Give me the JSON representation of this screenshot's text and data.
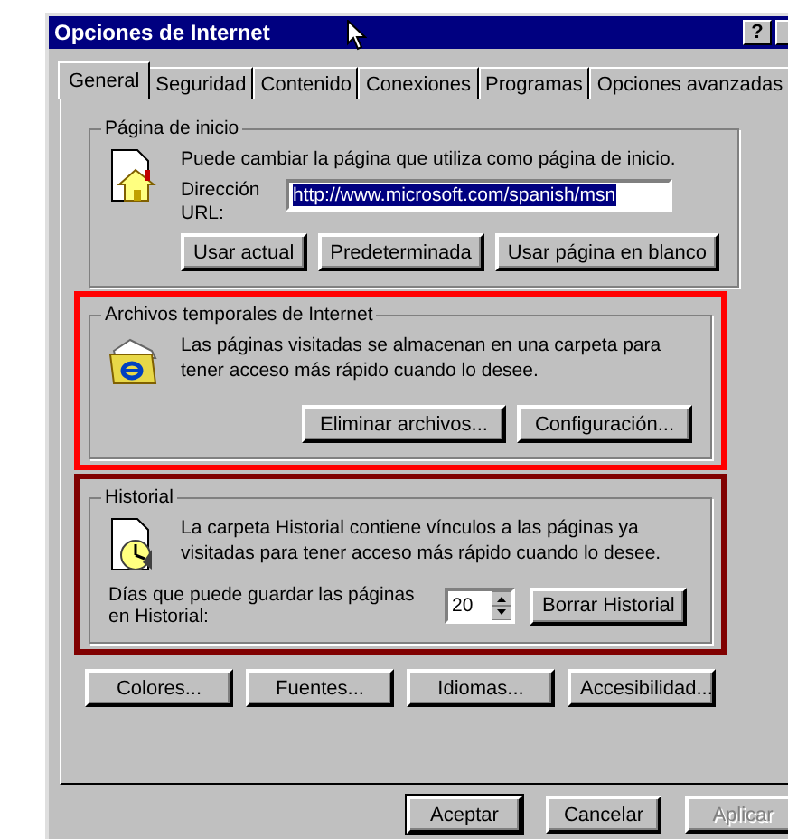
{
  "window": {
    "title": "Opciones de Internet",
    "help_button": "?"
  },
  "tabs": [
    {
      "label": "General",
      "selected": true
    },
    {
      "label": "Seguridad",
      "selected": false
    },
    {
      "label": "Contenido",
      "selected": false
    },
    {
      "label": "Conexiones",
      "selected": false
    },
    {
      "label": "Programas",
      "selected": false
    },
    {
      "label": "Opciones avanzadas",
      "selected": false
    }
  ],
  "home_page": {
    "title": "Página de inicio",
    "description": "Puede cambiar la página que utiliza como página de inicio.",
    "address_label": "Dirección URL:",
    "address": {
      "value": "http://www.microsoft.com/spanish/msn",
      "selected": true
    },
    "buttons": [
      "Usar actual",
      "Predeterminada",
      "Usar página en blanco"
    ]
  },
  "temp_files": {
    "title": "Archivos temporales de Internet",
    "color": "#ff0000",
    "description": "Las páginas visitadas se almacenan en una carpeta para tener acceso más rápido cuando lo desee.",
    "buttons": [
      "Eliminar archivos...",
      "Configuración..."
    ]
  },
  "history": {
    "title": "Historial",
    "color": "#800000",
    "description": "La carpeta Historial contiene vínculos a las páginas ya visitadas para tener acceso más rápido cuando lo desee.",
    "days_label": "Días que puede guardar las páginas en Historial:",
    "days": "20",
    "button": "Borrar Historial"
  },
  "appearance_buttons": [
    "Colores...",
    "Fuentes...",
    "Idiomas...",
    "Accesibilidad..."
  ],
  "dialog_buttons": [
    {
      "label": "Aceptar",
      "default": true,
      "disabled": false
    },
    {
      "label": "Cancelar",
      "default": false,
      "disabled": false
    },
    {
      "label": "Aplicar",
      "default": false,
      "disabled": true
    }
  ]
}
